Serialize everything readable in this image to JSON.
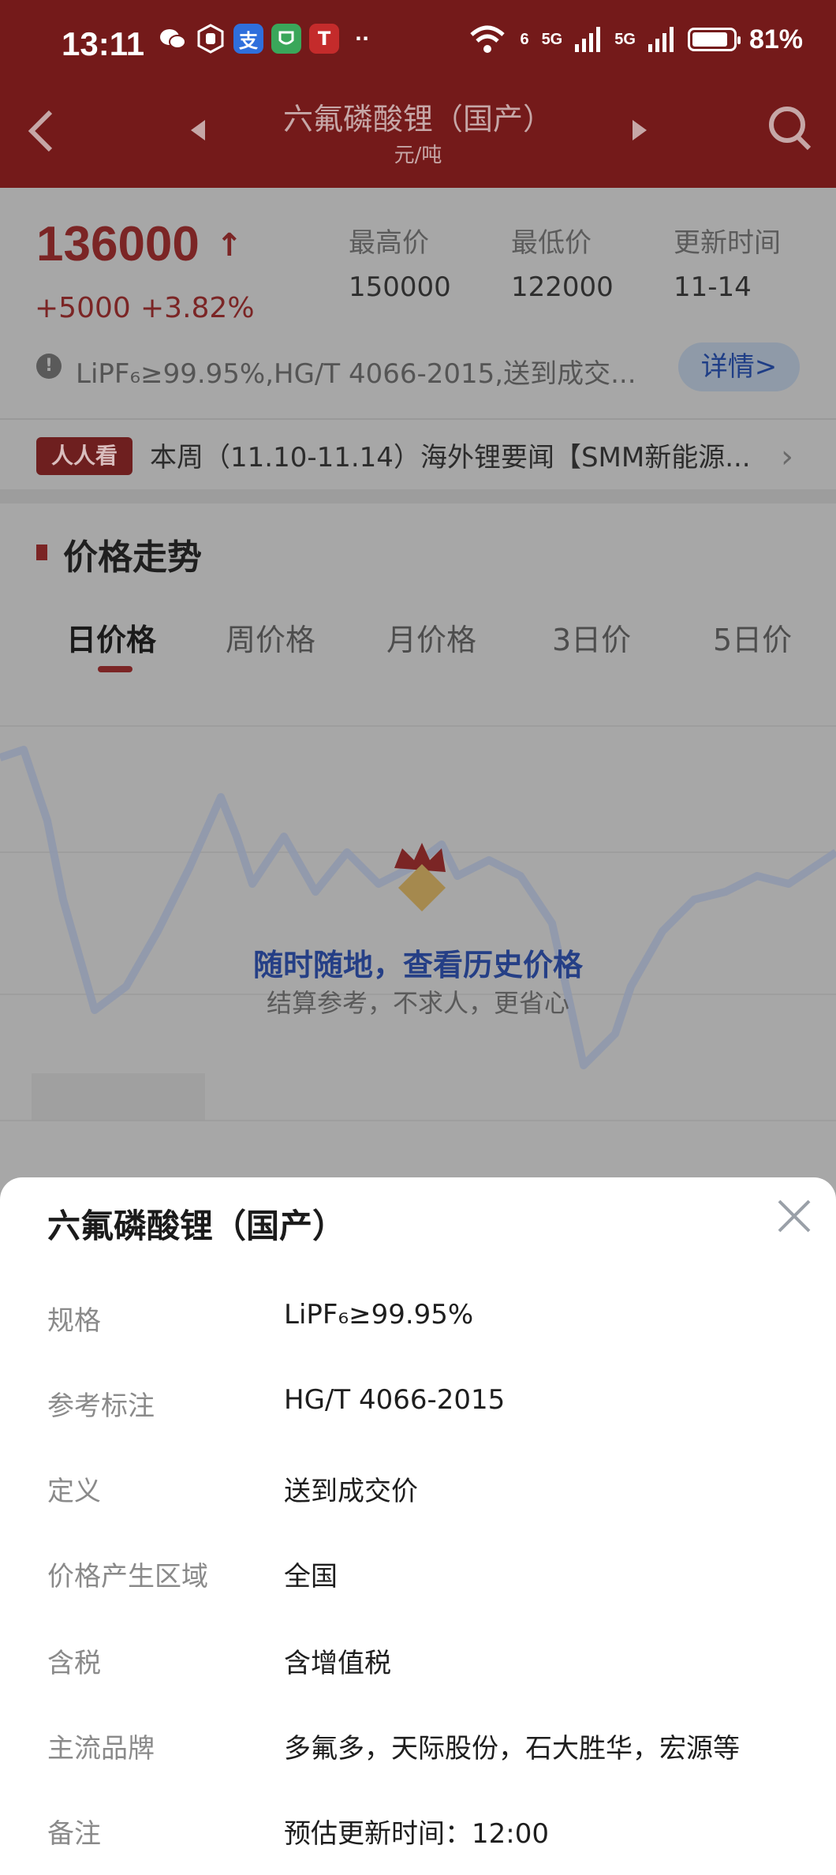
{
  "status": {
    "time": "13:11",
    "network_a": "6",
    "network_b": "5G",
    "network_c": "5G",
    "battery": "81%"
  },
  "header": {
    "title": "六氟磷酸锂（国产）",
    "unit": "元/吨"
  },
  "price": {
    "current": "136000",
    "arrow": "↑",
    "change": "+5000",
    "change_pct": "+3.82%",
    "stats": [
      {
        "label": "最高价",
        "value": "150000"
      },
      {
        "label": "最低价",
        "value": "122000"
      },
      {
        "label": "更新时间",
        "value": "11-14"
      }
    ],
    "spec_line": "LiPF₆≥99.95%,HG/T 4066-2015,送到成交...",
    "detail_button": "详情>"
  },
  "news": {
    "badge": "人人看",
    "text": "本周（11.10-11.14）海外锂要闻【SMM新能源..."
  },
  "section": {
    "title": "价格走势",
    "tabs": [
      "日价格",
      "周价格",
      "月价格",
      "3日价",
      "5日价"
    ],
    "active_tab": 0
  },
  "promo": {
    "title": "随时随地，查看历史价格",
    "subtitle": "结算参考，不求人，更省心"
  },
  "sheet": {
    "title": "六氟磷酸锂（国产）",
    "rows": [
      {
        "label": "规格",
        "value": "LiPF₆≥99.95%"
      },
      {
        "label": "参考标注",
        "value": "HG/T 4066-2015"
      },
      {
        "label": "定义",
        "value": "送到成交价"
      },
      {
        "label": "价格产生区域",
        "value": "全国"
      },
      {
        "label": "含税",
        "value": "含增值税"
      },
      {
        "label": "主流品牌",
        "value": "多氟多，天际股份，石大胜华，宏源等"
      },
      {
        "label": "备注",
        "value": "预估更新时间：12:00"
      }
    ]
  },
  "colors": {
    "brand_red": "#741a1a",
    "accent_blue": "#253f86"
  }
}
